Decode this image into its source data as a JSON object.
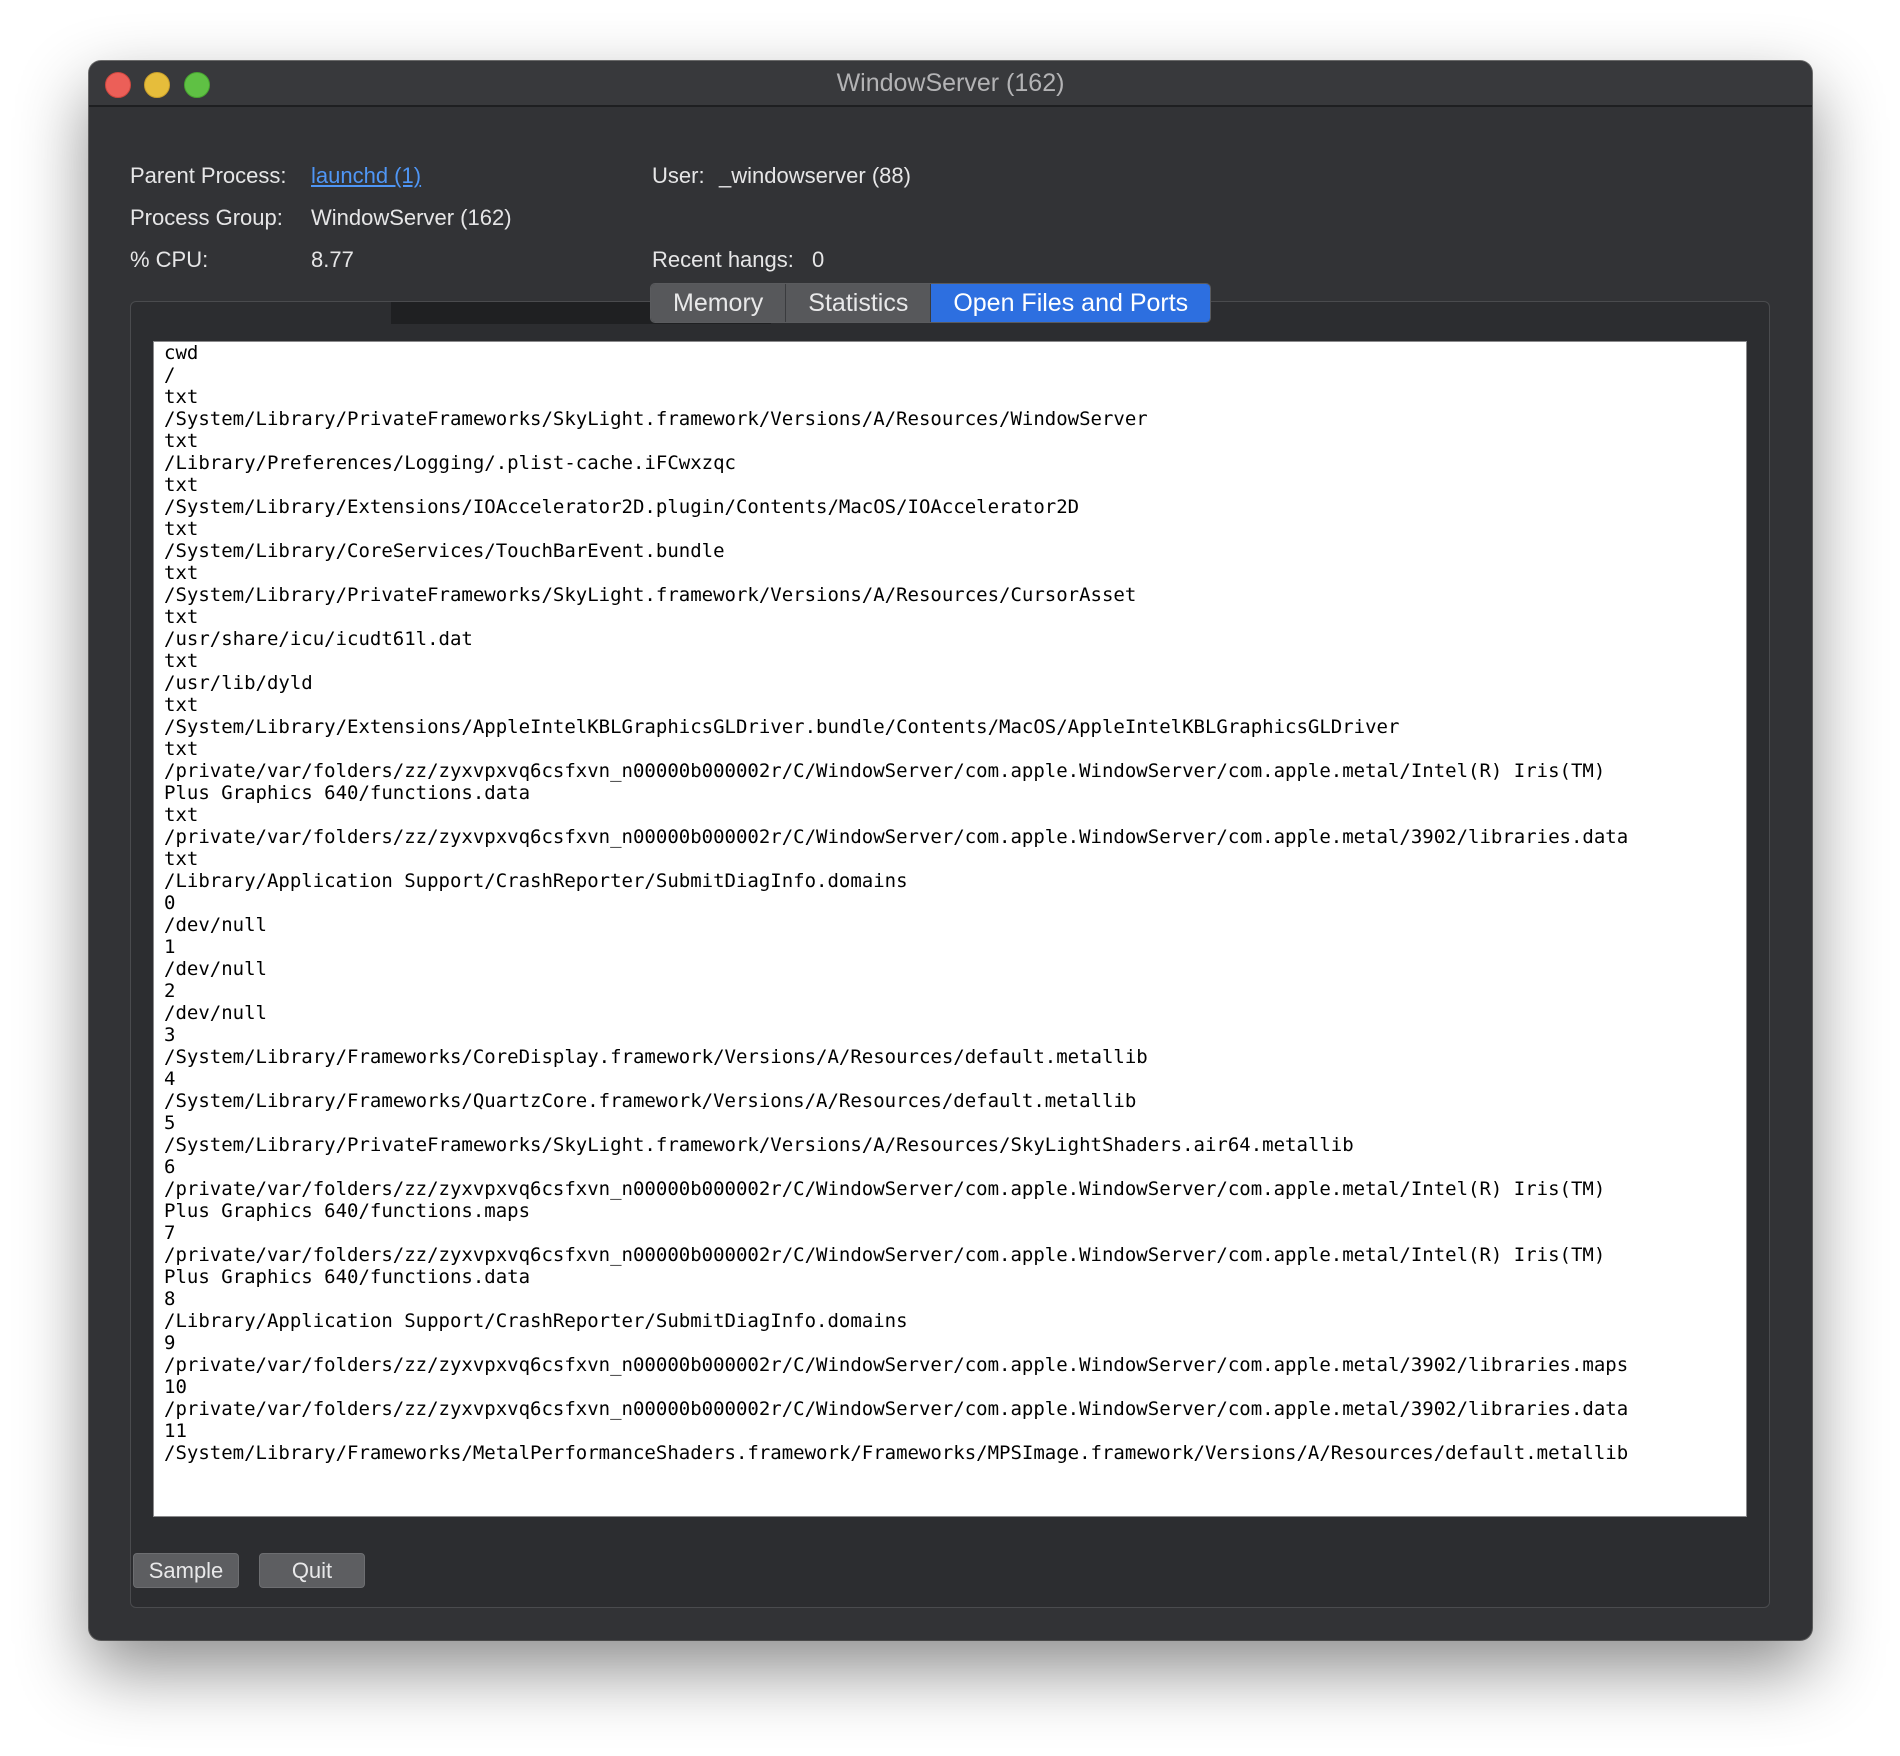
{
  "window": {
    "title": "WindowServer (162)"
  },
  "info": {
    "parent_process_label": "Parent Process:",
    "parent_process_value": "launchd (1)",
    "process_group_label": "Process Group:",
    "process_group_value": "WindowServer (162)",
    "cpu_label": "% CPU:",
    "cpu_value": "8.77",
    "user_label": "User:",
    "user_value": "_windowserver (88)",
    "recent_hangs_label": "Recent hangs:",
    "recent_hangs_value": "0"
  },
  "tabs": [
    {
      "label": "Memory",
      "selected": false
    },
    {
      "label": "Statistics",
      "selected": false
    },
    {
      "label": "Open Files and Ports",
      "selected": true
    }
  ],
  "open_files_text": "cwd\n/\ntxt\n/System/Library/PrivateFrameworks/SkyLight.framework/Versions/A/Resources/WindowServer\ntxt\n/Library/Preferences/Logging/.plist-cache.iFCwxzqc\ntxt\n/System/Library/Extensions/IOAccelerator2D.plugin/Contents/MacOS/IOAccelerator2D\ntxt\n/System/Library/CoreServices/TouchBarEvent.bundle\ntxt\n/System/Library/PrivateFrameworks/SkyLight.framework/Versions/A/Resources/CursorAsset\ntxt\n/usr/share/icu/icudt61l.dat\ntxt\n/usr/lib/dyld\ntxt\n/System/Library/Extensions/AppleIntelKBLGraphicsGLDriver.bundle/Contents/MacOS/AppleIntelKBLGraphicsGLDriver\ntxt\n/private/var/folders/zz/zyxvpxvq6csfxvn_n00000b000002r/C/WindowServer/com.apple.WindowServer/com.apple.metal/Intel(R) Iris(TM)\nPlus Graphics 640/functions.data\ntxt\n/private/var/folders/zz/zyxvpxvq6csfxvn_n00000b000002r/C/WindowServer/com.apple.WindowServer/com.apple.metal/3902/libraries.data\ntxt\n/Library/Application Support/CrashReporter/SubmitDiagInfo.domains\n0\n/dev/null\n1\n/dev/null\n2\n/dev/null\n3\n/System/Library/Frameworks/CoreDisplay.framework/Versions/A/Resources/default.metallib\n4\n/System/Library/Frameworks/QuartzCore.framework/Versions/A/Resources/default.metallib\n5\n/System/Library/PrivateFrameworks/SkyLight.framework/Versions/A/Resources/SkyLightShaders.air64.metallib\n6\n/private/var/folders/zz/zyxvpxvq6csfxvn_n00000b000002r/C/WindowServer/com.apple.WindowServer/com.apple.metal/Intel(R) Iris(TM)\nPlus Graphics 640/functions.maps\n7\n/private/var/folders/zz/zyxvpxvq6csfxvn_n00000b000002r/C/WindowServer/com.apple.WindowServer/com.apple.metal/Intel(R) Iris(TM)\nPlus Graphics 640/functions.data\n8\n/Library/Application Support/CrashReporter/SubmitDiagInfo.domains\n9\n/private/var/folders/zz/zyxvpxvq6csfxvn_n00000b000002r/C/WindowServer/com.apple.WindowServer/com.apple.metal/3902/libraries.maps\n10\n/private/var/folders/zz/zyxvpxvq6csfxvn_n00000b000002r/C/WindowServer/com.apple.WindowServer/com.apple.metal/3902/libraries.data\n11\n/System/Library/Frameworks/MetalPerformanceShaders.framework/Frameworks/MPSImage.framework/Versions/A/Resources/default.metallib",
  "buttons": {
    "sample_label": "Sample",
    "quit_label": "Quit"
  },
  "colors": {
    "window_bg": "#323336",
    "accent": "#2d6fe0",
    "link": "#4f96f5",
    "close": "#ec5f58",
    "minimize": "#e6bd3b",
    "zoom": "#5fc144"
  }
}
